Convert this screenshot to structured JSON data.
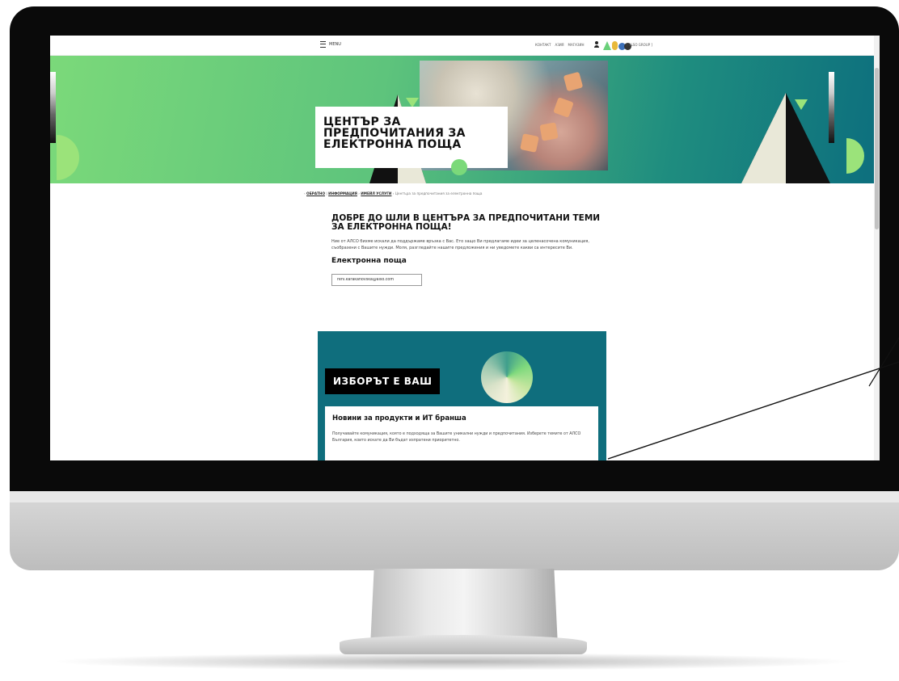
{
  "nav": {
    "menu_label": "MENU",
    "links": [
      "КОНТАКТ",
      "АЗИЯ",
      "МАГАЗИН"
    ],
    "group_label": "[ ALSO GROUP ]"
  },
  "hero": {
    "title_line1": "ЦЕНТЪР ЗА",
    "title_line2": "ПРЕДПОЧИТАНИЯ ЗА",
    "title_line3": "ЕЛЕКТРОННА ПОЩА"
  },
  "breadcrumb": {
    "item1": "ОБРАТНО",
    "item2": "ИНФОРМАЦИЯ",
    "item3": "ИМЕЙЛ УСЛУГИ",
    "current": "Центъра за предпочитания за електронна поща"
  },
  "main": {
    "heading_line1": "ДОБРЕ ДО ШЛИ В ЦЕНТЪРА ЗА ПРЕДПОЧИТАНИ ТЕМИ",
    "heading_line2": "ЗА ЕЛЕКТРОННА ПОЩА!",
    "intro": "Ние от АЛСО бихме искали да поддържаме връзка с Вас. Ето защо Ви предлагаме идеи за целенасочена комуникация, съобразени с Вашите нужди. Моля, разгледайте нашите предложения и ни уведомете какви са интересите Ви.",
    "email_heading": "Електронна поща",
    "email_value": "reni.karakanovska@also.com"
  },
  "choice": {
    "badge": "ИЗБОРЪТ Е ВАШ",
    "news_title": "Новини за продукти и ИТ бранша",
    "news_text": "Получавайте комуникация, която е подходяща за Вашите уникални нужди и предпочитания. Изберете темите от АЛСО България, които искате да Ви бъдат изпратени приоритетно."
  },
  "colors": {
    "hero_green": "#7bd97a",
    "hero_teal": "#0d6f7e",
    "card_teal": "#0f6e7d"
  }
}
